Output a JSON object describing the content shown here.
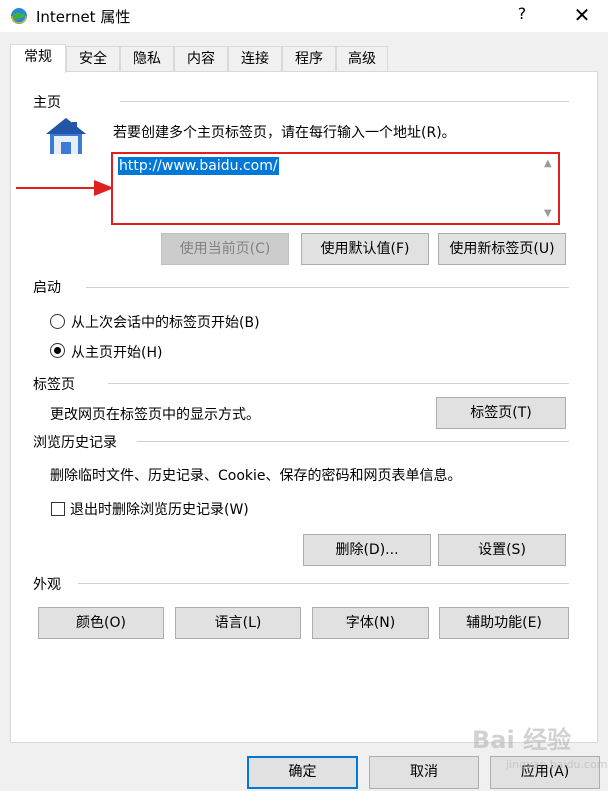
{
  "window": {
    "title": "Internet 属性",
    "help": "?",
    "close": "✕"
  },
  "tabs": [
    {
      "label": "常规",
      "active": true
    },
    {
      "label": "安全"
    },
    {
      "label": "隐私"
    },
    {
      "label": "内容"
    },
    {
      "label": "连接"
    },
    {
      "label": "程序"
    },
    {
      "label": "高级"
    }
  ],
  "homepage": {
    "group_label": "主页",
    "instruction": "若要创建多个主页标签页，请在每行输入一个地址(R)。",
    "url": "http://www.baidu.com/",
    "use_current_label": "使用当前页(C)",
    "use_default_label": "使用默认值(F)",
    "use_new_tab_label": "使用新标签页(U)"
  },
  "startup": {
    "group_label": "启动",
    "options": [
      {
        "label": "从上次会话中的标签页开始(B)",
        "selected": false
      },
      {
        "label": "从主页开始(H)",
        "selected": true
      }
    ]
  },
  "tabs_section": {
    "group_label": "标签页",
    "description": "更改网页在标签页中的显示方式。",
    "button_label": "标签页(T)"
  },
  "history": {
    "group_label": "浏览历史记录",
    "description": "删除临时文件、历史记录、Cookie、保存的密码和网页表单信息。",
    "checkbox_label": "退出时删除浏览历史记录(W)",
    "checkbox_checked": false,
    "delete_label": "删除(D)...",
    "settings_label": "设置(S)"
  },
  "appearance": {
    "group_label": "外观",
    "colors_label": "颜色(O)",
    "languages_label": "语言(L)",
    "fonts_label": "字体(N)",
    "accessibility_label": "辅助功能(E)"
  },
  "footer": {
    "ok_label": "确定",
    "cancel_label": "取消",
    "apply_label": "应用(A)"
  },
  "watermark": {
    "brand": "Bai 经验",
    "site": "jingyan.baidu.com"
  },
  "colors": {
    "accent": "#0078d7",
    "highlight_border": "#e02020",
    "arrow": "#e02020"
  }
}
